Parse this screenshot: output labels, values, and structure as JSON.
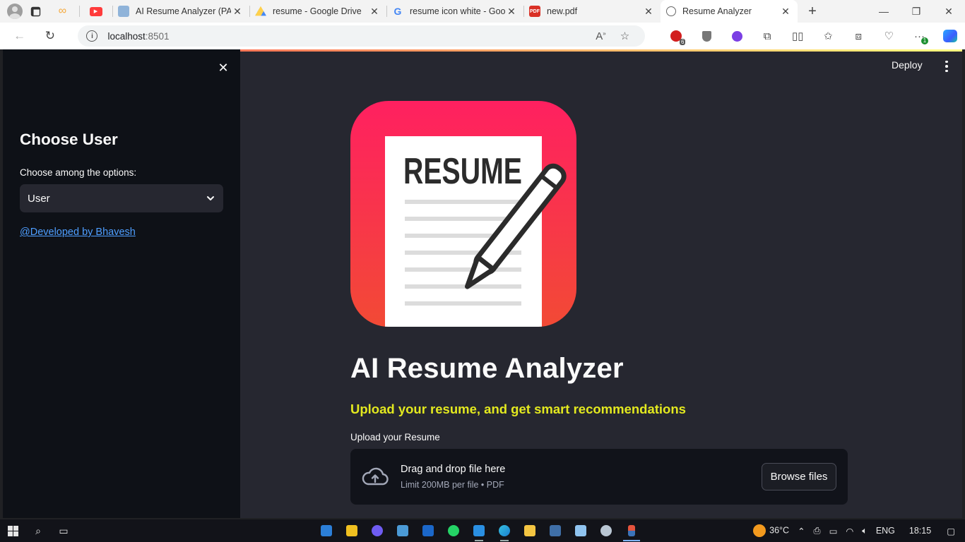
{
  "browser": {
    "tabs": [
      {
        "title": "AI Resume Analyzer (PAF",
        "favicon": "doc-blue"
      },
      {
        "title": "resume - Google Drive",
        "favicon": "google-drive"
      },
      {
        "title": "resume icon white - Goo",
        "favicon": "google"
      },
      {
        "title": "new.pdf",
        "favicon": "pdf"
      },
      {
        "title": "Resume Analyzer",
        "favicon": "globe",
        "active": true
      }
    ],
    "url_host": "localhost",
    "url_port": ":8501",
    "extension_badge": "6",
    "copilot_badge": "1"
  },
  "sidebar": {
    "title": "Choose User",
    "select_label": "Choose among the options:",
    "select_value": "User",
    "credit_link": "@Developed by Bhavesh"
  },
  "header": {
    "deploy_label": "Deploy"
  },
  "main": {
    "logo_word": "RESUME",
    "title": "AI Resume Analyzer",
    "subtitle": "Upload your resume, and get smart recommendations",
    "uploader": {
      "label": "Upload your Resume",
      "drop_text": "Drag and drop file here",
      "limit_text": "Limit 200MB per file • PDF",
      "browse_label": "Browse files"
    }
  },
  "taskbar": {
    "weather_temp": "36°C",
    "language": "ENG",
    "time": "18:15"
  },
  "colors": {
    "app_bg": "#262730",
    "sidebar_bg": "#0e1117",
    "subtitle_yellow": "#e3e91f",
    "link_blue": "#4e9eff",
    "logo_gradient_top": "#ff2060",
    "logo_gradient_bottom": "#f24a35"
  }
}
